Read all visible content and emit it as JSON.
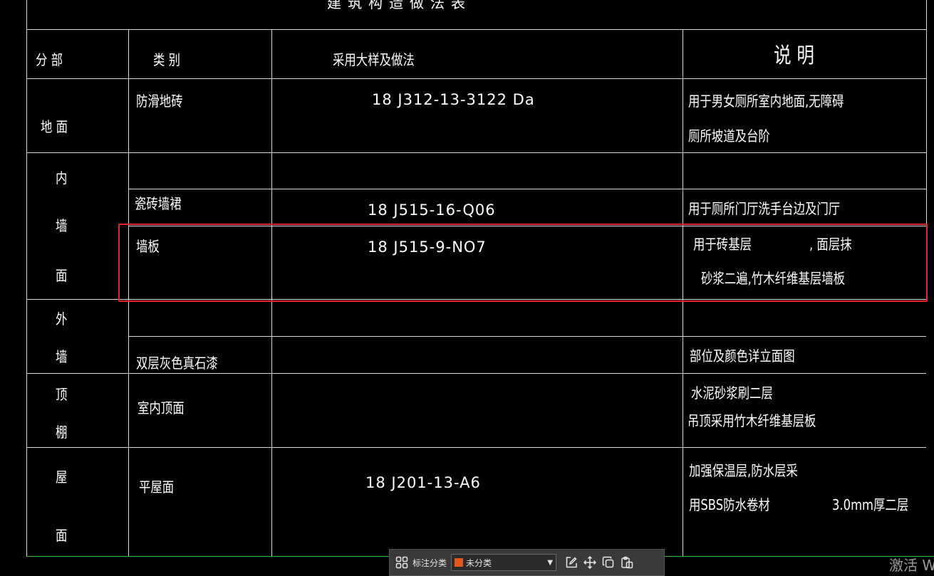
{
  "table": {
    "title_partial": "建筑构造做法表",
    "headers": {
      "section": "分 部",
      "category": "类   别",
      "method": "采用大样及做法",
      "note": "说   明"
    },
    "sections": {
      "floor": "地   面",
      "inner_wall_1": "内",
      "inner_wall_2": "墙",
      "inner_wall_3": "面",
      "outer_wall_1": "外",
      "outer_wall_2": "墙",
      "ceiling_1": "顶",
      "ceiling_2": "棚",
      "roof_1": "屋",
      "roof_2": "面"
    },
    "rows": {
      "anti_slip": {
        "category": "防滑地砖",
        "code": "18 J312-13-3122 Da",
        "note1": "用于男女厕所室内地面,无障碍",
        "note2": "厕所坡道及台阶"
      },
      "tile_dado": {
        "category": "瓷砖墙裙",
        "code": "18 J515-16-Q06",
        "note1": "用于厕所门厅洗手台边及门厅"
      },
      "wall_board": {
        "category": "墙板",
        "code": "18 J515-9-NO7",
        "note1": "用于砖基层",
        "note1b": ",  面层抹",
        "note2": "砂浆二遍,竹木纤维基层墙板"
      },
      "stone_paint": {
        "category": "双层灰色真石漆",
        "note1": "部位及颜色详立面图"
      },
      "indoor_ceiling": {
        "category": "室内顶面",
        "note1": "水泥砂浆刷二层",
        "note2": "吊顶采用竹木纤维基层板"
      },
      "flat_roof": {
        "category": "平屋面",
        "code": "18 J201-13-A6",
        "note1": "加强保温层,防水层采",
        "note2": "用SBS防水卷材",
        "note2b": "3.0mm厚二层"
      }
    }
  },
  "toolbar": {
    "label": "标注分类",
    "selected": "未分类",
    "swatch_color": "#e2571e"
  },
  "watermark": "激活 W",
  "colors": {
    "highlight": "#e0262a",
    "border_green": "#2fbf2f"
  }
}
